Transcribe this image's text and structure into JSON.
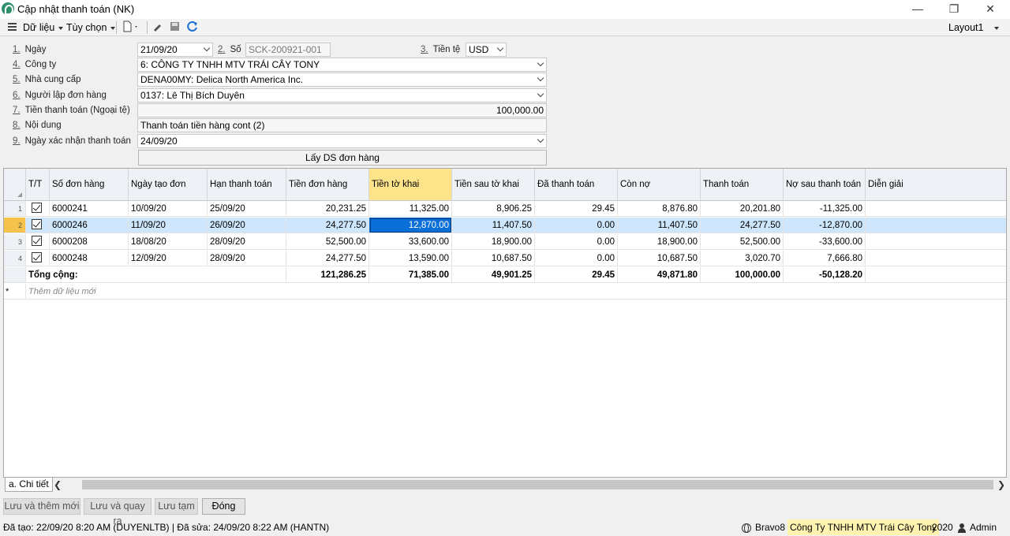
{
  "window": {
    "title": "Cập nhật thanh toán (NK)",
    "min_glyph": "—",
    "restore_glyph": "❐",
    "close_glyph": "✕"
  },
  "toolbar": {
    "menu_data": "Dữ liệu",
    "menu_options": "Tùy chọn",
    "layout": "Layout1"
  },
  "form": {
    "date": {
      "num": "1.",
      "label": "Ngày",
      "value": "21/09/20"
    },
    "so": {
      "num": "2.",
      "label": "Số",
      "value": "SCK-200921-001"
    },
    "currency": {
      "num": "3.",
      "label": "Tiền tệ",
      "value": "USD"
    },
    "company": {
      "num": "4.",
      "label": "Công ty",
      "value": "6: CÔNG TY TNHH MTV TRÁI CÂY TONY"
    },
    "supplier": {
      "num": "5.",
      "label": "Nhà cung cấp",
      "value": "DENA00MY: Delica North America Inc."
    },
    "creator": {
      "num": "6.",
      "label": "Người lập đơn hàng",
      "value": "0137: Lê Thị Bích Duyên"
    },
    "amount": {
      "num": "7.",
      "label": "Tiền thanh toán (Ngoại tệ)",
      "value": "100,000.00"
    },
    "content": {
      "num": "8.",
      "label": "Nội dung",
      "value": "Thanh toán tiền hàng cont (2)"
    },
    "confirm_date": {
      "num": "9.",
      "label": "Ngày xác nhận thanh toán",
      "value": "24/09/20"
    },
    "fetch_button": "Lấy DS đơn hàng"
  },
  "grid": {
    "columns": [
      "T/T",
      "Số đơn hàng",
      "Ngày tạo đơn",
      "Hạn thanh toán",
      "Tiền đơn hàng",
      "Tiền tờ khai",
      "Tiền sau tờ khai",
      "Đã thanh toán",
      "Còn nợ",
      "Thanh toán",
      "Nợ sau thanh toán",
      "Diễn giải"
    ],
    "rows": [
      {
        "rn": "1",
        "so": "6000241",
        "ngay_tao": "10/09/20",
        "han": "25/09/20",
        "tien_don": "20,231.25",
        "tien_to_khai": "11,325.00",
        "tien_sau": "8,906.25",
        "da_tt": "29.45",
        "con_no": "8,876.80",
        "thanh_toan": "20,201.80",
        "no_sau": "-11,325.00",
        "dien_giai": ""
      },
      {
        "rn": "2",
        "so": "6000246",
        "ngay_tao": "11/09/20",
        "han": "26/09/20",
        "tien_don": "24,277.50",
        "tien_to_khai": "12,870.00",
        "tien_sau": "11,407.50",
        "da_tt": "0.00",
        "con_no": "11,407.50",
        "thanh_toan": "24,277.50",
        "no_sau": "-12,870.00",
        "dien_giai": ""
      },
      {
        "rn": "3",
        "so": "6000208",
        "ngay_tao": "18/08/20",
        "han": "28/09/20",
        "tien_don": "52,500.00",
        "tien_to_khai": "33,600.00",
        "tien_sau": "18,900.00",
        "da_tt": "0.00",
        "con_no": "18,900.00",
        "thanh_toan": "52,500.00",
        "no_sau": "-33,600.00",
        "dien_giai": ""
      },
      {
        "rn": "4",
        "so": "6000248",
        "ngay_tao": "12/09/20",
        "han": "28/09/20",
        "tien_don": "24,277.50",
        "tien_to_khai": "13,590.00",
        "tien_sau": "10,687.50",
        "da_tt": "0.00",
        "con_no": "10,687.50",
        "thanh_toan": "3,020.70",
        "no_sau": "7,666.80",
        "dien_giai": ""
      }
    ],
    "total": {
      "label": "Tổng cộng:",
      "tien_don": "121,286.25",
      "tien_to_khai": "71,385.00",
      "tien_sau": "49,901.25",
      "da_tt": "29.45",
      "con_no": "49,871.80",
      "thanh_toan": "100,000.00",
      "no_sau": "-50,128.20"
    },
    "new_row_marker": "*",
    "new_row_hint": "Thêm dữ liệu mới"
  },
  "tabs": {
    "detail": "a. Chi tiết"
  },
  "buttons": {
    "save_new": "Lưu và thêm mới",
    "save_back": "Lưu và quay ra",
    "save_temp": "Lưu tạm",
    "close": "Đóng"
  },
  "status": {
    "left": "Đã tạo: 22/09/20 8:20 AM (DUYENLTB) | Đã sửa: 24/09/20 8:22 AM (HANTN)",
    "app": "Bravo8",
    "company": "Công Ty TNHH MTV Trái Cây Tony",
    "year": "2020",
    "user": "Admin"
  },
  "colors": {
    "selected_row": "#cde6fb",
    "focused_cell": "#0a6fd6",
    "active_header": "#fde38a"
  }
}
